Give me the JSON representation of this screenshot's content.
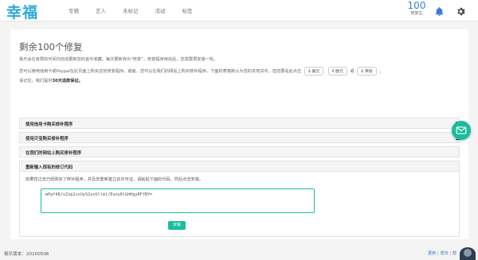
{
  "brand": {
    "logo": "幸福",
    "color": "#2aa9d8"
  },
  "nav": {
    "items": [
      "专辑",
      "艺人",
      "未标记",
      "活动",
      "标签"
    ]
  },
  "header": {
    "repairs_count": "100",
    "repairs_label": "修复左",
    "bell_icon": "bell-icon",
    "settings_icon": "gear-icon"
  },
  "main": {
    "title": "剩余100个修复",
    "line1": "极乐会在有限的时间内自动更新您的音乐收藏。每次更新称为“修复”。修复程序用完后，您需要再安装一些。",
    "line2": {
      "text": "您可以使用信用卡或Paypal在此页面上购买这些修复程序。或者，您可以在我们的网站上购买修补程序。下面的表格默认为您的本地货币，但您要是此点击",
      "options": [
        "$ 美元",
        "€ 欧元",
        "£ 英镑"
      ],
      "or": "或",
      "end": "。"
    },
    "line3": {
      "prefix": "请记住，我们提供",
      "bold": "30天退款保证。"
    },
    "accordions": [
      "使用信用卡购买修补程序",
      "使用贝宝购买修补程序",
      "在我们的网站上购买修补程序",
      "重新输入现有的修订代码"
    ],
    "hint": "如果您过去已经购买了修补程序，并且您重新建立此许可证，请粘贴下面的代码，然后点击安装。",
    "code": "mPpf46/oZzp2ssUyS2yxUllml/Eunu0lGhHgyRFfBY=",
    "install_label": "安装"
  },
  "footer": {
    "version": "极乐版本：20200506",
    "links": [
      "更新",
      "想法",
      "帮"
    ]
  },
  "colors": {
    "accent": "#1abc9c",
    "link": "#3a7bd5"
  }
}
